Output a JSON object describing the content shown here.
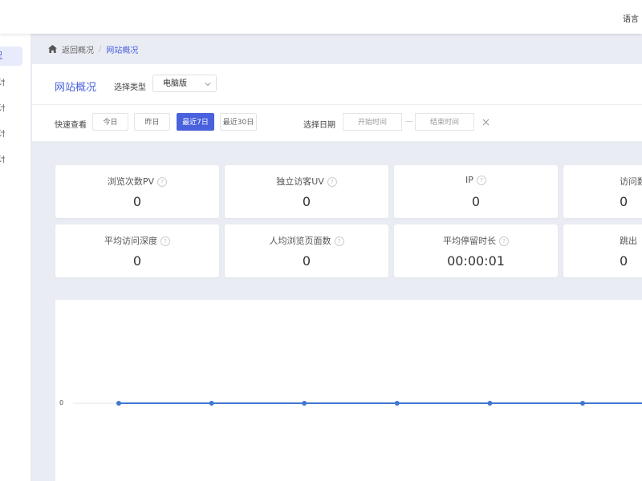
{
  "header": {
    "language_label": "语言"
  },
  "sidebar": {
    "active_item": "况",
    "collapsed_items": [
      "计",
      "计",
      "计",
      "计"
    ]
  },
  "breadcrumb": {
    "back_label": "返回概况",
    "separator": "/",
    "current": "网站概况"
  },
  "filters": {
    "title": "网站概况",
    "type_label": "选择类型",
    "type_value": "电脑版",
    "quick_label": "快速查看",
    "quick_options": [
      "今日",
      "昨日",
      "最近7日",
      "最近30日"
    ],
    "active_quick": "最近7日",
    "date_label": "选择日期",
    "start_placeholder": "开始时间",
    "end_placeholder": "结束时间",
    "range_separator": "—"
  },
  "metrics": [
    {
      "label": "浏览次数PV",
      "value": "0"
    },
    {
      "label": "独立访客UV",
      "value": "0"
    },
    {
      "label": "IP",
      "value": "0"
    },
    {
      "label": "访问数",
      "value": "0"
    },
    {
      "label": "平均访问深度",
      "value": "0"
    },
    {
      "label": "人均浏览页面数",
      "value": "0"
    },
    {
      "label": "平均停留时长",
      "value": "00:00:01"
    },
    {
      "label": "跳出",
      "value": "0"
    }
  ],
  "help_icon_glyph": "?",
  "chart_data": {
    "type": "line",
    "y_tick_labels": [
      "0"
    ],
    "series": [
      {
        "values": [
          0,
          0,
          0,
          0,
          0,
          0,
          0
        ]
      }
    ],
    "color": "#3f78d1",
    "grid": false
  },
  "colors": {
    "accent": "#4a61dd",
    "line": "#3f78d1"
  }
}
